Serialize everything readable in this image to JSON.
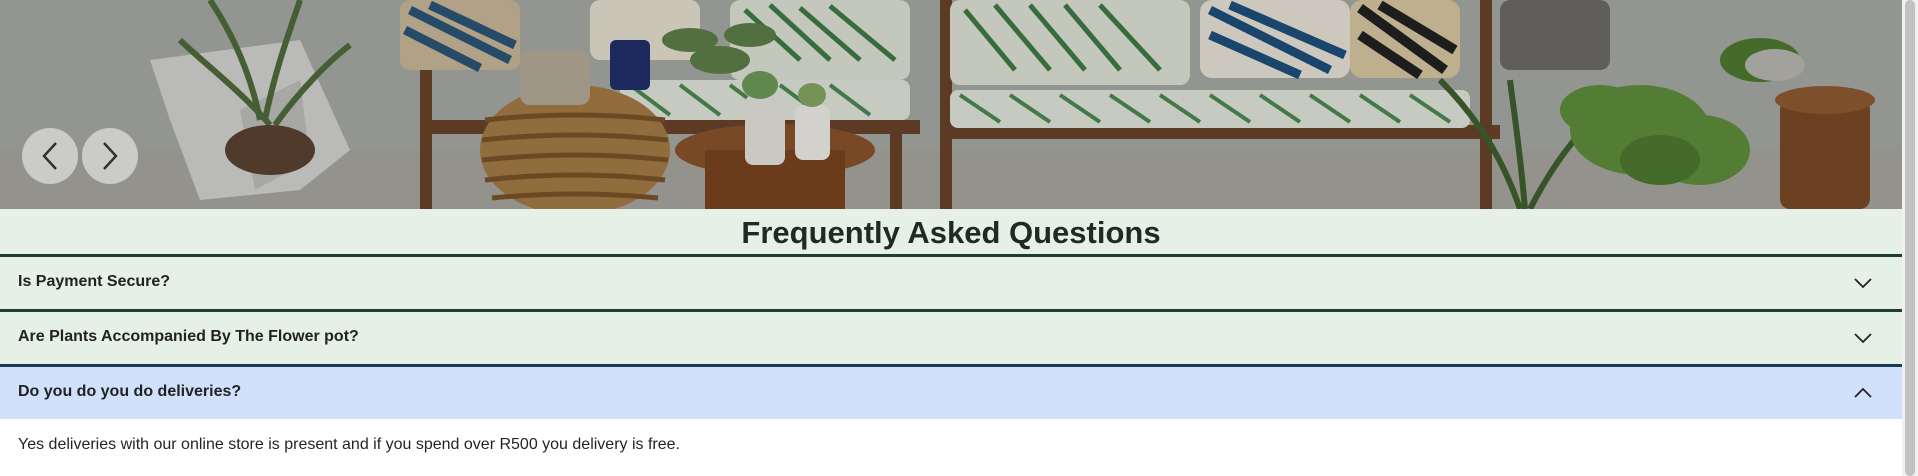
{
  "hero": {
    "prev_label": "Previous slide",
    "next_label": "Next slide"
  },
  "faq": {
    "title": "Frequently Asked Questions",
    "items": [
      {
        "question": "Is Payment Secure?",
        "expanded": false
      },
      {
        "question": "Are Plants Accompanied By The Flower pot?",
        "expanded": false
      },
      {
        "question": "Do you do you do deliveries?",
        "expanded": true,
        "answer": "Yes deliveries with our online store is present and if you spend over R500 you delivery is free."
      }
    ]
  },
  "colors": {
    "faq_background": "#e5f1e6",
    "expanded_header": "#d1e1fb",
    "divider": "#1f3b34"
  }
}
